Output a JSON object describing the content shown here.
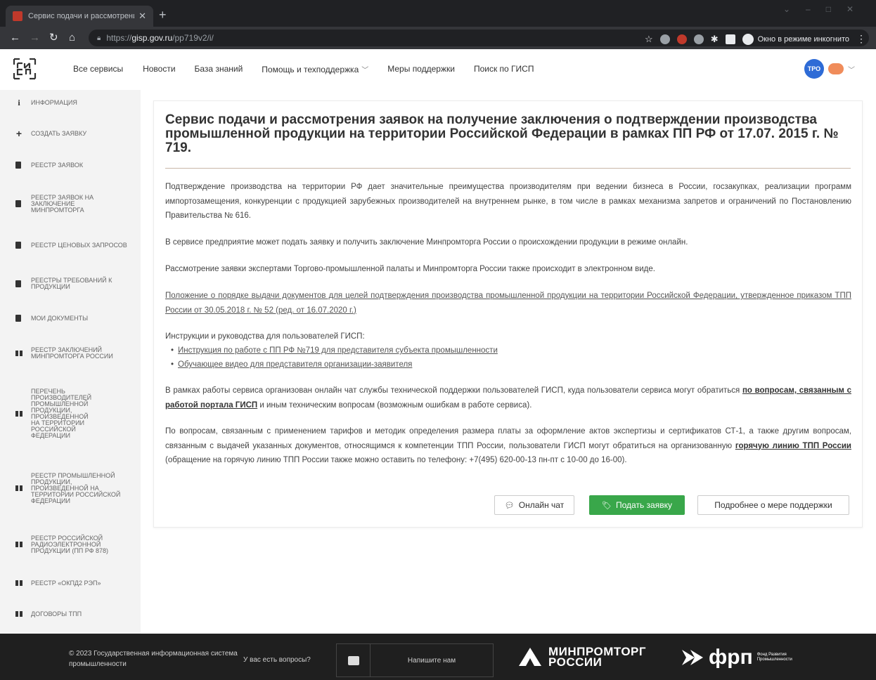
{
  "browser": {
    "tab_title": "Сервис подачи и рассмотрения",
    "url_scheme": "https://",
    "url_host": "gisp.gov.ru",
    "url_path": "/pp719v2/i/",
    "incognito_label": "Окно в режиме инкогнито"
  },
  "header": {
    "nav": [
      {
        "label": "Все сервисы"
      },
      {
        "label": "Новости"
      },
      {
        "label": "База знаний"
      },
      {
        "label": "Помощь и техподдержка"
      },
      {
        "label": "Меры поддержки"
      },
      {
        "label": "Поиск по ГИСП"
      }
    ],
    "user_initials": "ТРО"
  },
  "sidebar": {
    "items": [
      {
        "label": "ИНФОРМАЦИЯ",
        "icon": "info-icon"
      },
      {
        "label": "СОЗДАТЬ ЗАЯВКУ",
        "icon": "plus-icon"
      },
      {
        "label": "РЕЕСТР ЗАЯВОК",
        "icon": "document-icon"
      },
      {
        "label": "РЕЕСТР ЗАЯВОК НА ЗАКЛЮЧЕНИЕ МИНПРОМТОРГА",
        "icon": "document-icon"
      },
      {
        "label": "РЕЕСТР ЦЕНОВЫХ ЗАПРОСОВ",
        "icon": "document-icon"
      },
      {
        "label": "РЕЕСТРЫ ТРЕБОВАНИЙ К ПРОДУКЦИИ",
        "icon": "document-icon"
      },
      {
        "label": "МОИ ДОКУМЕНТЫ",
        "icon": "document-icon"
      },
      {
        "label": "РЕЕСТР ЗАКЛЮЧЕНИЙ МИНПРОМТОРГА РОССИИ",
        "icon": "book-icon"
      },
      {
        "label": "ПЕРЕЧЕНЬ ПРОИЗВОДИТЕЛЕЙ ПРОМЫШЛЕННОЙ ПРОДУКЦИИ, ПРОИЗВЕДЕННОЙ НА ТЕРРИТОРИИ РОССИЙСКОЙ ФЕДЕРАЦИИ",
        "icon": "book-icon"
      },
      {
        "label": "РЕЕСТР ПРОМЫШЛЕННОЙ ПРОДУКЦИИ, ПРОИЗВЕДЕННОЙ НА ТЕРРИТОРИИ РОССИЙСКОЙ ФЕДЕРАЦИИ",
        "icon": "book-icon"
      },
      {
        "label": "РЕЕСТР РОССИЙСКОЙ РАДИОЭЛЕКТРОННОЙ ПРОДУКЦИИ (ПП РФ 878)",
        "icon": "book-icon"
      },
      {
        "label": "РЕЕСТР «ОКПД2 РЭП»",
        "icon": "book-icon"
      },
      {
        "label": "ДОГОВОРЫ ТПП",
        "icon": "book-icon"
      }
    ]
  },
  "main": {
    "title": "Сервис подачи и рассмотрения заявок на получение заключения о подтверждении производства промышленной продукции на территории Российской Федерации в рамках ПП РФ от 17.07. 2015 г. № 719.",
    "p1": "Подтверждение производства на территории РФ дает значительные преимущества производителям при ведении бизнеса в России, госзакупках, реализации программ импортозамещения, конкуренции с продукцией зарубежных производителей на внутреннем рынке, в том числе в рамках механизма запретов и ограничений по Постановлению Правительства № 616.",
    "p2": "В сервисе предприятие может подать заявку и получить заключение Минпромторга России о происхождении продукции в режиме онлайн.",
    "p3": "Рассмотрение заявки экспертами Торгово-промышленной палаты и Минпромторга России также происходит в электронном виде.",
    "regulation_link": "Положение о порядке выдачи документов для целей подтверждения производства промышленной продукции на территории Российской Федерации, утвержденное приказом ТПП России от 30.05.2018 г. № 52 (ред. от 16.07.2020 г.)",
    "instructions_heading": "Инструкции и руководства для пользователей ГИСП:",
    "instructions": [
      {
        "label": "Инструкция по работе с ПП РФ №719 для представителя субъекта промышленности"
      },
      {
        "label": "Обучающее видео для представителя организации-заявителя"
      }
    ],
    "chat_para_start": "В рамках работы сервиса организован онлайн чат службы технической поддержки пользователей ГИСП, куда пользователи сервиса могут обратиться ",
    "chat_para_link": "по вопросам, связанным с работой портала ГИСП",
    "chat_para_end": " и иным техническим вопросам (возможным ошибкам в работе сервиса).",
    "tpp_para_start": "По вопросам, связанным с применением тарифов и методик определения размера платы за оформление актов экспертизы и сертификатов СТ-1, а также другим вопросам, связанным с выдачей указанных документов, относящимся к компетенции ТПП России, пользователи ГИСП могут обратиться на организованную ",
    "tpp_para_link": "горячую линию ТПП России",
    "tpp_para_end": " (обращение на горячую линию ТПП России также можно оставить по телефону: +7(495) 620-00-13 пн-пт с 10-00 до 16-00).",
    "buttons": {
      "chat": "Онлайн чат",
      "submit": "Подать заявку",
      "more": "Подробнее о мере поддержки"
    }
  },
  "footer": {
    "copyright": "© 2023 Государственная информационная система промышленности",
    "question": "У вас есть вопросы?",
    "write_us": "Напишите нам",
    "logo1": "МИНПРОМТОРГ РОССИИ",
    "logo2": "фрп",
    "logo2_sub": "Фонд Развития Промышленности"
  },
  "colors": {
    "accent_green": "#39a74a",
    "user_blue": "#2e6bd6",
    "footer_bg": "#1f1f1f"
  }
}
